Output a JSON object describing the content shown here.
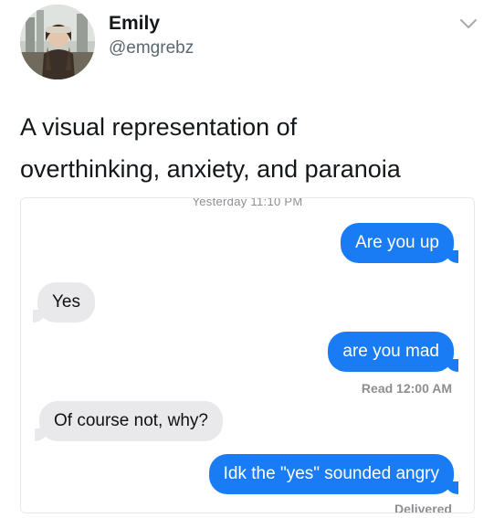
{
  "tweet": {
    "display_name": "Emily",
    "handle": "@emgrebz",
    "text_lines": [
      "A visual representation of",
      "overthinking, anxiety, and paranoia"
    ],
    "menu_icon": "chevron-down-icon"
  },
  "conversation": {
    "timestamp": "Yesterday 11:10 PM",
    "messages": [
      {
        "side": "sent",
        "text": "Are you up"
      },
      {
        "side": "received",
        "text": "Yes"
      },
      {
        "side": "sent",
        "text": "are you mad"
      },
      {
        "side": "received",
        "text": "Of course not, why?"
      },
      {
        "side": "sent",
        "text": "Idk the \"yes\" sounded angry"
      }
    ],
    "read_receipt": "Read 12:00 AM",
    "delivered_receipt": "Delivered"
  },
  "colors": {
    "sent_bubble": "#1a7cf5",
    "received_bubble": "#e9e9eb",
    "receipt_text": "#8e8e93"
  }
}
